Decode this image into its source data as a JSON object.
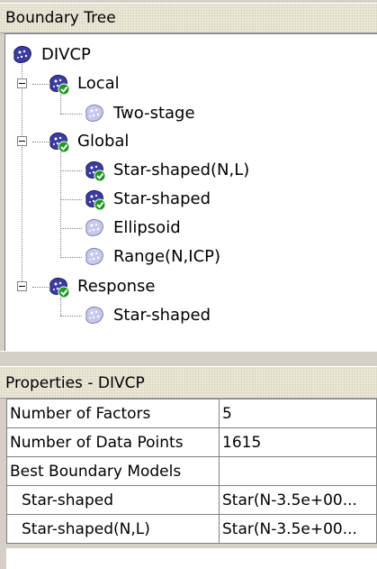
{
  "tree_panel": {
    "title": "Boundary Tree"
  },
  "tree": {
    "root": {
      "label": "DIVCP",
      "icon": "blob-icon"
    },
    "local": {
      "label": "Local",
      "icon": "blob-check-icon",
      "children": [
        {
          "label": "Two-stage",
          "icon": "blob-faded-icon"
        }
      ]
    },
    "global": {
      "label": "Global",
      "icon": "blob-check-icon",
      "children": [
        {
          "label": "Star-shaped(N,L)",
          "icon": "blob-check-icon"
        },
        {
          "label": "Star-shaped",
          "icon": "blob-check-icon"
        },
        {
          "label": "Ellipsoid",
          "icon": "blob-faded-icon"
        },
        {
          "label": "Range(N,ICP)",
          "icon": "blob-faded-icon"
        }
      ]
    },
    "response": {
      "label": "Response",
      "icon": "blob-check-icon",
      "children": [
        {
          "label": "Star-shaped",
          "icon": "blob-faded-icon"
        }
      ]
    }
  },
  "properties_panel": {
    "title": "Properties - DIVCP"
  },
  "properties": [
    {
      "name": "Number of Factors",
      "value": "5"
    },
    {
      "name": "Number of Data Points",
      "value": "1615"
    },
    {
      "name": "Best Boundary Models",
      "value": ""
    },
    {
      "name": "Star-shaped",
      "value": "Star(N-3.5e+00..."
    },
    {
      "name": "Star-shaped(N,L)",
      "value": "Star(N-3.5e+00..."
    }
  ],
  "colors": {
    "blob": "#3c3ca0",
    "blob_faded": "#b8b8e0",
    "check": "#1a9a1a"
  }
}
